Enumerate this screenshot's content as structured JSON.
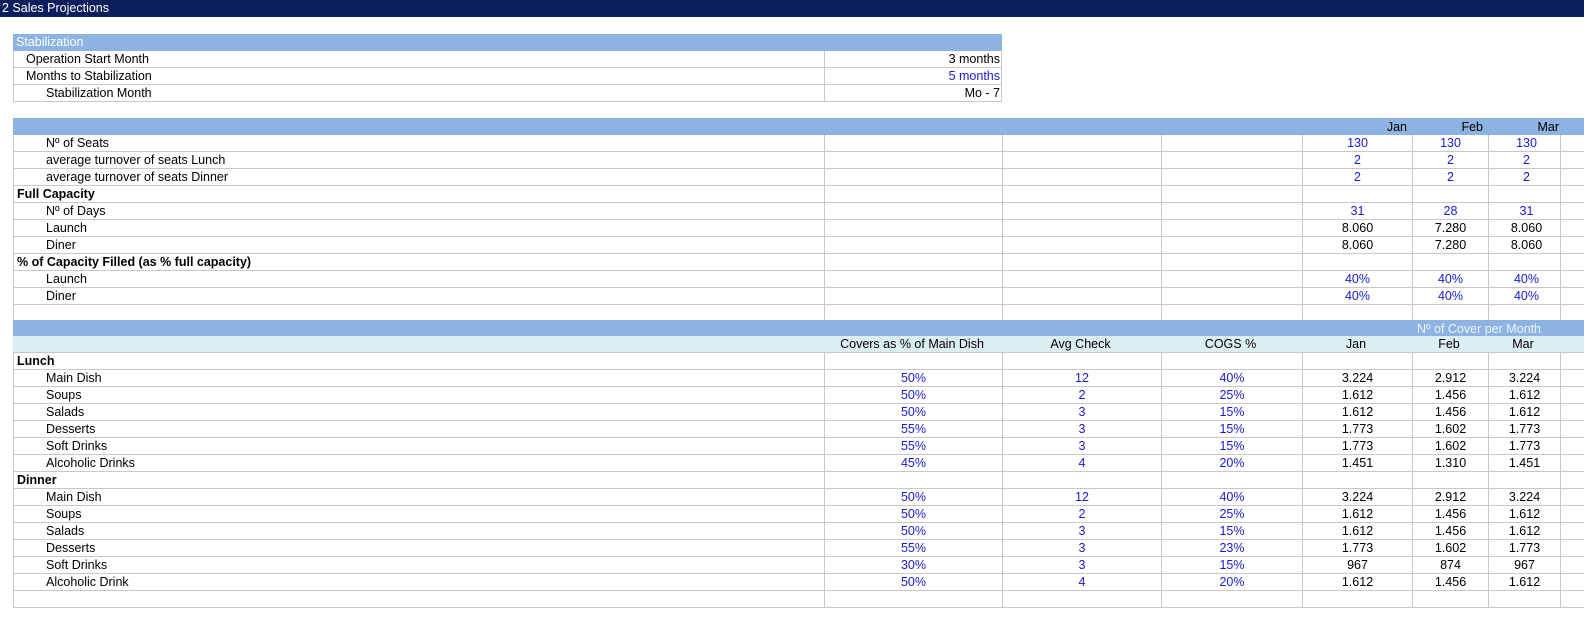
{
  "sheet_title": "2 Sales  Projections",
  "stabilization": {
    "header": "Stabilization",
    "rows": [
      {
        "label": "Operation Start Month",
        "value": "3 months",
        "blue": false,
        "indent": 1
      },
      {
        "label": "Months to Stabilization",
        "value": "5 months",
        "blue": true,
        "indent": 1
      },
      {
        "label": "Stabilization Month",
        "value": "Mo -  7",
        "blue": false,
        "indent": 2
      }
    ]
  },
  "capacity": {
    "months": [
      "Jan",
      "Feb",
      "Mar"
    ],
    "rows": [
      {
        "label": "Nº of Seats",
        "type": "item",
        "values": [
          "130",
          "130",
          "130"
        ],
        "blue": true
      },
      {
        "label": "average turnover of seats Lunch",
        "type": "item",
        "values": [
          "2",
          "2",
          "2"
        ],
        "blue": true
      },
      {
        "label": "average turnover of seats Dinner",
        "type": "item",
        "values": [
          "2",
          "2",
          "2"
        ],
        "blue": true
      },
      {
        "label": "Full Capacity",
        "type": "section",
        "values": [
          "",
          "",
          ""
        ],
        "blue": false
      },
      {
        "label": "Nº of Days",
        "type": "item",
        "values": [
          "31",
          "28",
          "31"
        ],
        "blue": true
      },
      {
        "label": "Launch",
        "type": "item",
        "values": [
          "8.060",
          "7.280",
          "8.060"
        ],
        "blue": false
      },
      {
        "label": "Diner",
        "type": "item",
        "values": [
          "8.060",
          "7.280",
          "8.060"
        ],
        "blue": false
      },
      {
        "label": "% of Capacity Filled (as % full capacity)",
        "type": "section",
        "values": [
          "",
          "",
          ""
        ],
        "blue": false
      },
      {
        "label": "Launch",
        "type": "item",
        "values": [
          "40%",
          "40%",
          "40%"
        ],
        "blue": true
      },
      {
        "label": "Diner",
        "type": "item",
        "values": [
          "40%",
          "40%",
          "40%"
        ],
        "blue": true
      },
      {
        "label": "",
        "type": "blank",
        "values": [
          "",
          "",
          ""
        ],
        "blue": false
      }
    ]
  },
  "covers": {
    "band_label": "Nº of Cover per Month",
    "col_headers": [
      "Covers as % of Main Dish",
      "Avg Check",
      "COGS %",
      "Jan",
      "Feb",
      "Mar"
    ],
    "rows": [
      {
        "label": "Lunch",
        "type": "section",
        "vals": [
          "",
          "",
          "",
          "",
          "",
          ""
        ]
      },
      {
        "label": "Main Dish",
        "type": "item",
        "vals": [
          "50%",
          "12",
          "40%",
          "3.224",
          "2.912",
          "3.224"
        ]
      },
      {
        "label": "Soups",
        "type": "item",
        "vals": [
          "50%",
          "2",
          "25%",
          "1.612",
          "1.456",
          "1.612"
        ]
      },
      {
        "label": "Salads",
        "type": "item",
        "vals": [
          "50%",
          "3",
          "15%",
          "1.612",
          "1.456",
          "1.612"
        ]
      },
      {
        "label": "Desserts",
        "type": "item",
        "vals": [
          "55%",
          "3",
          "15%",
          "1.773",
          "1.602",
          "1.773"
        ]
      },
      {
        "label": "Soft Drinks",
        "type": "item",
        "vals": [
          "55%",
          "3",
          "15%",
          "1.773",
          "1.602",
          "1.773"
        ]
      },
      {
        "label": "Alcoholic Drinks",
        "type": "item",
        "vals": [
          "45%",
          "4",
          "20%",
          "1.451",
          "1.310",
          "1.451"
        ]
      },
      {
        "label": "Dinner",
        "type": "section",
        "vals": [
          "",
          "",
          "",
          "",
          "",
          ""
        ]
      },
      {
        "label": "Main Dish",
        "type": "item",
        "vals": [
          "50%",
          "12",
          "40%",
          "3.224",
          "2.912",
          "3.224"
        ]
      },
      {
        "label": "Soups",
        "type": "item",
        "vals": [
          "50%",
          "2",
          "25%",
          "1.612",
          "1.456",
          "1.612"
        ]
      },
      {
        "label": "Salads",
        "type": "item",
        "vals": [
          "50%",
          "3",
          "15%",
          "1.612",
          "1.456",
          "1.612"
        ]
      },
      {
        "label": "Desserts",
        "type": "item",
        "vals": [
          "55%",
          "3",
          "23%",
          "1.773",
          "1.602",
          "1.773"
        ]
      },
      {
        "label": "Soft Drinks",
        "type": "item",
        "vals": [
          "30%",
          "3",
          "15%",
          "967",
          "874",
          "967"
        ]
      },
      {
        "label": "Alcoholic Drink",
        "type": "item",
        "vals": [
          "50%",
          "4",
          "20%",
          "1.612",
          "1.456",
          "1.612"
        ]
      },
      {
        "label": "",
        "type": "blank",
        "vals": [
          "",
          "",
          "",
          "",
          "",
          ""
        ]
      }
    ]
  },
  "colors": {
    "title_bar": "#0b1f5c",
    "header_band": "#8db3e2",
    "header_light": "#dbeef4",
    "input_blue": "#1a1ad0",
    "grid": "#c8c8c8"
  }
}
